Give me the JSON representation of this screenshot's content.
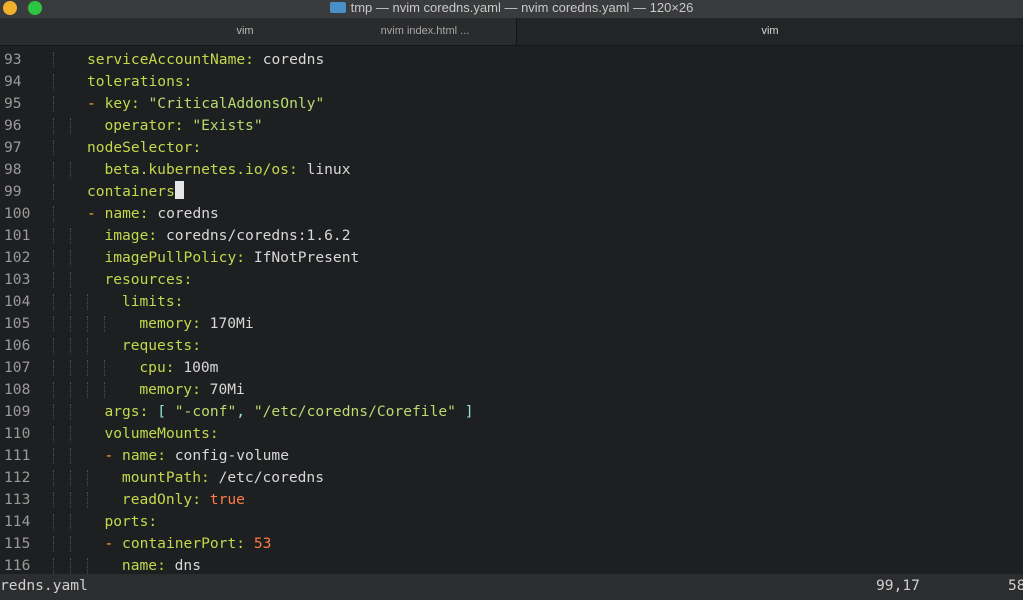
{
  "window": {
    "title": "tmp — nvim coredns.yaml — nvim coredns.yaml — 120×26"
  },
  "tabs": [
    {
      "label": "vim"
    },
    {
      "label": "nvim index.html ..."
    },
    {
      "label": "vim"
    }
  ],
  "editor": {
    "lines": [
      {
        "n": "93",
        "indent": 2,
        "parts": [
          {
            "t": "serviceAccountName",
            "c": "k"
          },
          {
            "t": ": ",
            "c": "p"
          },
          {
            "t": "coredns",
            "c": "v"
          }
        ]
      },
      {
        "n": "94",
        "indent": 2,
        "parts": [
          {
            "t": "tolerations",
            "c": "k"
          },
          {
            "t": ":",
            "c": "p"
          }
        ]
      },
      {
        "n": "95",
        "indent": 2,
        "parts": [
          {
            "t": "- ",
            "c": "d"
          },
          {
            "t": "key",
            "c": "k"
          },
          {
            "t": ": ",
            "c": "p"
          },
          {
            "t": "\"CriticalAddonsOnly\"",
            "c": "s"
          }
        ]
      },
      {
        "n": "96",
        "indent": 3,
        "parts": [
          {
            "t": "operator",
            "c": "k"
          },
          {
            "t": ": ",
            "c": "p"
          },
          {
            "t": "\"Exists\"",
            "c": "s"
          }
        ]
      },
      {
        "n": "97",
        "indent": 2,
        "parts": [
          {
            "t": "nodeSelector",
            "c": "k"
          },
          {
            "t": ":",
            "c": "p"
          }
        ]
      },
      {
        "n": "98",
        "indent": 3,
        "parts": [
          {
            "t": "beta.kubernetes.io/os",
            "c": "k"
          },
          {
            "t": ": ",
            "c": "p"
          },
          {
            "t": "linux",
            "c": "v"
          }
        ]
      },
      {
        "n": "99",
        "indent": 2,
        "parts": [
          {
            "t": "containers",
            "c": "k"
          }
        ],
        "cursor": true
      },
      {
        "n": "100",
        "indent": 2,
        "parts": [
          {
            "t": "- ",
            "c": "d"
          },
          {
            "t": "name",
            "c": "k"
          },
          {
            "t": ": ",
            "c": "p"
          },
          {
            "t": "coredns",
            "c": "v"
          }
        ]
      },
      {
        "n": "101",
        "indent": 3,
        "parts": [
          {
            "t": "image",
            "c": "k"
          },
          {
            "t": ": ",
            "c": "p"
          },
          {
            "t": "coredns/coredns:1.6.2",
            "c": "v"
          }
        ]
      },
      {
        "n": "102",
        "indent": 3,
        "parts": [
          {
            "t": "imagePullPolicy",
            "c": "k"
          },
          {
            "t": ": ",
            "c": "p"
          },
          {
            "t": "IfNotPresent",
            "c": "v"
          }
        ]
      },
      {
        "n": "103",
        "indent": 3,
        "parts": [
          {
            "t": "resources",
            "c": "k"
          },
          {
            "t": ":",
            "c": "p"
          }
        ]
      },
      {
        "n": "104",
        "indent": 4,
        "parts": [
          {
            "t": "limits",
            "c": "k"
          },
          {
            "t": ":",
            "c": "p"
          }
        ]
      },
      {
        "n": "105",
        "indent": 5,
        "parts": [
          {
            "t": "memory",
            "c": "k"
          },
          {
            "t": ": ",
            "c": "p"
          },
          {
            "t": "170Mi",
            "c": "v"
          }
        ]
      },
      {
        "n": "106",
        "indent": 4,
        "parts": [
          {
            "t": "requests",
            "c": "k"
          },
          {
            "t": ":",
            "c": "p"
          }
        ]
      },
      {
        "n": "107",
        "indent": 5,
        "parts": [
          {
            "t": "cpu",
            "c": "k"
          },
          {
            "t": ": ",
            "c": "p"
          },
          {
            "t": "100m",
            "c": "v"
          }
        ]
      },
      {
        "n": "108",
        "indent": 5,
        "parts": [
          {
            "t": "memory",
            "c": "k"
          },
          {
            "t": ": ",
            "c": "p"
          },
          {
            "t": "70Mi",
            "c": "v"
          }
        ]
      },
      {
        "n": "109",
        "indent": 3,
        "parts": [
          {
            "t": "args",
            "c": "k"
          },
          {
            "t": ": ",
            "c": "p"
          },
          {
            "t": "[ ",
            "c": "b"
          },
          {
            "t": "\"-conf\"",
            "c": "s"
          },
          {
            "t": ", ",
            "c": "b"
          },
          {
            "t": "\"/etc/coredns/Corefile\"",
            "c": "s"
          },
          {
            "t": " ]",
            "c": "b"
          }
        ]
      },
      {
        "n": "110",
        "indent": 3,
        "parts": [
          {
            "t": "volumeMounts",
            "c": "k"
          },
          {
            "t": ":",
            "c": "p"
          }
        ]
      },
      {
        "n": "111",
        "indent": 3,
        "parts": [
          {
            "t": "- ",
            "c": "d"
          },
          {
            "t": "name",
            "c": "k"
          },
          {
            "t": ": ",
            "c": "p"
          },
          {
            "t": "config-volume",
            "c": "v"
          }
        ]
      },
      {
        "n": "112",
        "indent": 4,
        "parts": [
          {
            "t": "mountPath",
            "c": "k"
          },
          {
            "t": ": ",
            "c": "p"
          },
          {
            "t": "/etc/coredns",
            "c": "v"
          }
        ]
      },
      {
        "n": "113",
        "indent": 4,
        "parts": [
          {
            "t": "readOnly",
            "c": "k"
          },
          {
            "t": ": ",
            "c": "p"
          },
          {
            "t": "true",
            "c": "n"
          }
        ]
      },
      {
        "n": "114",
        "indent": 3,
        "parts": [
          {
            "t": "ports",
            "c": "k"
          },
          {
            "t": ":",
            "c": "p"
          }
        ]
      },
      {
        "n": "115",
        "indent": 3,
        "parts": [
          {
            "t": "- ",
            "c": "d"
          },
          {
            "t": "containerPort",
            "c": "k"
          },
          {
            "t": ": ",
            "c": "p"
          },
          {
            "t": "53",
            "c": "n"
          }
        ]
      },
      {
        "n": "116",
        "indent": 4,
        "parts": [
          {
            "t": "name",
            "c": "k"
          },
          {
            "t": ": ",
            "c": "p"
          },
          {
            "t": "dns",
            "c": "v"
          }
        ]
      }
    ]
  },
  "statusline": {
    "filename": "redns.yaml",
    "position": "99,17",
    "percent": "58"
  }
}
